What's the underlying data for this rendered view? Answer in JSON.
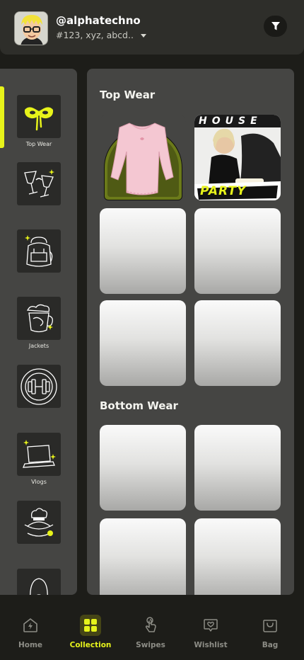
{
  "header": {
    "username": "@alphatechno",
    "handle": "#123, xyz, abcd.."
  },
  "sidebar": {
    "items": [
      {
        "label": "Top Wear",
        "icon": "mask-icon"
      },
      {
        "label": "",
        "icon": "cocktail-glasses-icon"
      },
      {
        "label": "",
        "icon": "backpack-icon"
      },
      {
        "label": "Jackets",
        "icon": "coffee-mug-icon"
      },
      {
        "label": "",
        "icon": "dumbbell-icon"
      },
      {
        "label": "Vlogs",
        "icon": "laptop-icon"
      },
      {
        "label": "",
        "icon": "chef-hat-icon"
      },
      {
        "label": "",
        "icon": "hoodie-icon"
      }
    ]
  },
  "main": {
    "sections": [
      {
        "title": "Top Wear"
      },
      {
        "title": "Bottom Wear"
      }
    ],
    "house_card": {
      "line1": "HOUSE",
      "line2": "PARTY"
    }
  },
  "nav": {
    "items": [
      {
        "label": "Home",
        "icon": "home-lightning-icon",
        "active": false
      },
      {
        "label": "Collection",
        "icon": "grid-icon",
        "active": true
      },
      {
        "label": "Swipes",
        "icon": "swipe-hand-icon",
        "active": false
      },
      {
        "label": "Wishlist",
        "icon": "heart-chat-icon",
        "active": false
      },
      {
        "label": "Bag",
        "icon": "bag-icon",
        "active": false
      }
    ]
  },
  "colors": {
    "accent": "#e6f31c",
    "panel": "#454543",
    "background": "#1d1d19"
  }
}
